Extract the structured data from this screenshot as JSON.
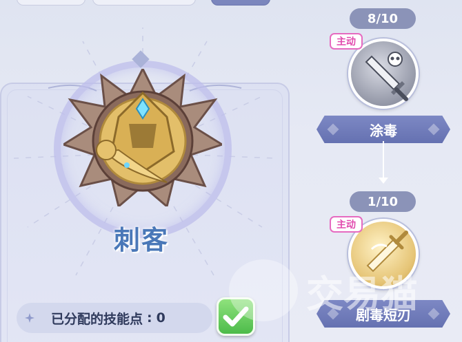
{
  "class": {
    "name": "刺客"
  },
  "skill_points": {
    "label": "已分配的技能点",
    "separator": ":",
    "value": "0"
  },
  "skills": [
    {
      "level": "8/10",
      "tag": "主动",
      "name": "涂毒",
      "icon": "poison-dagger-icon",
      "state": "gray"
    },
    {
      "level": "1/10",
      "tag": "主动",
      "name": "剧毒短刃",
      "icon": "venom-blade-icon",
      "state": "gold"
    }
  ],
  "watermark": "交易猫",
  "colors": {
    "skill_banner": "#6f7aba",
    "active_tag": "#e14aae",
    "class_name": "#4a78b8",
    "confirm": "#4dbb4a"
  }
}
